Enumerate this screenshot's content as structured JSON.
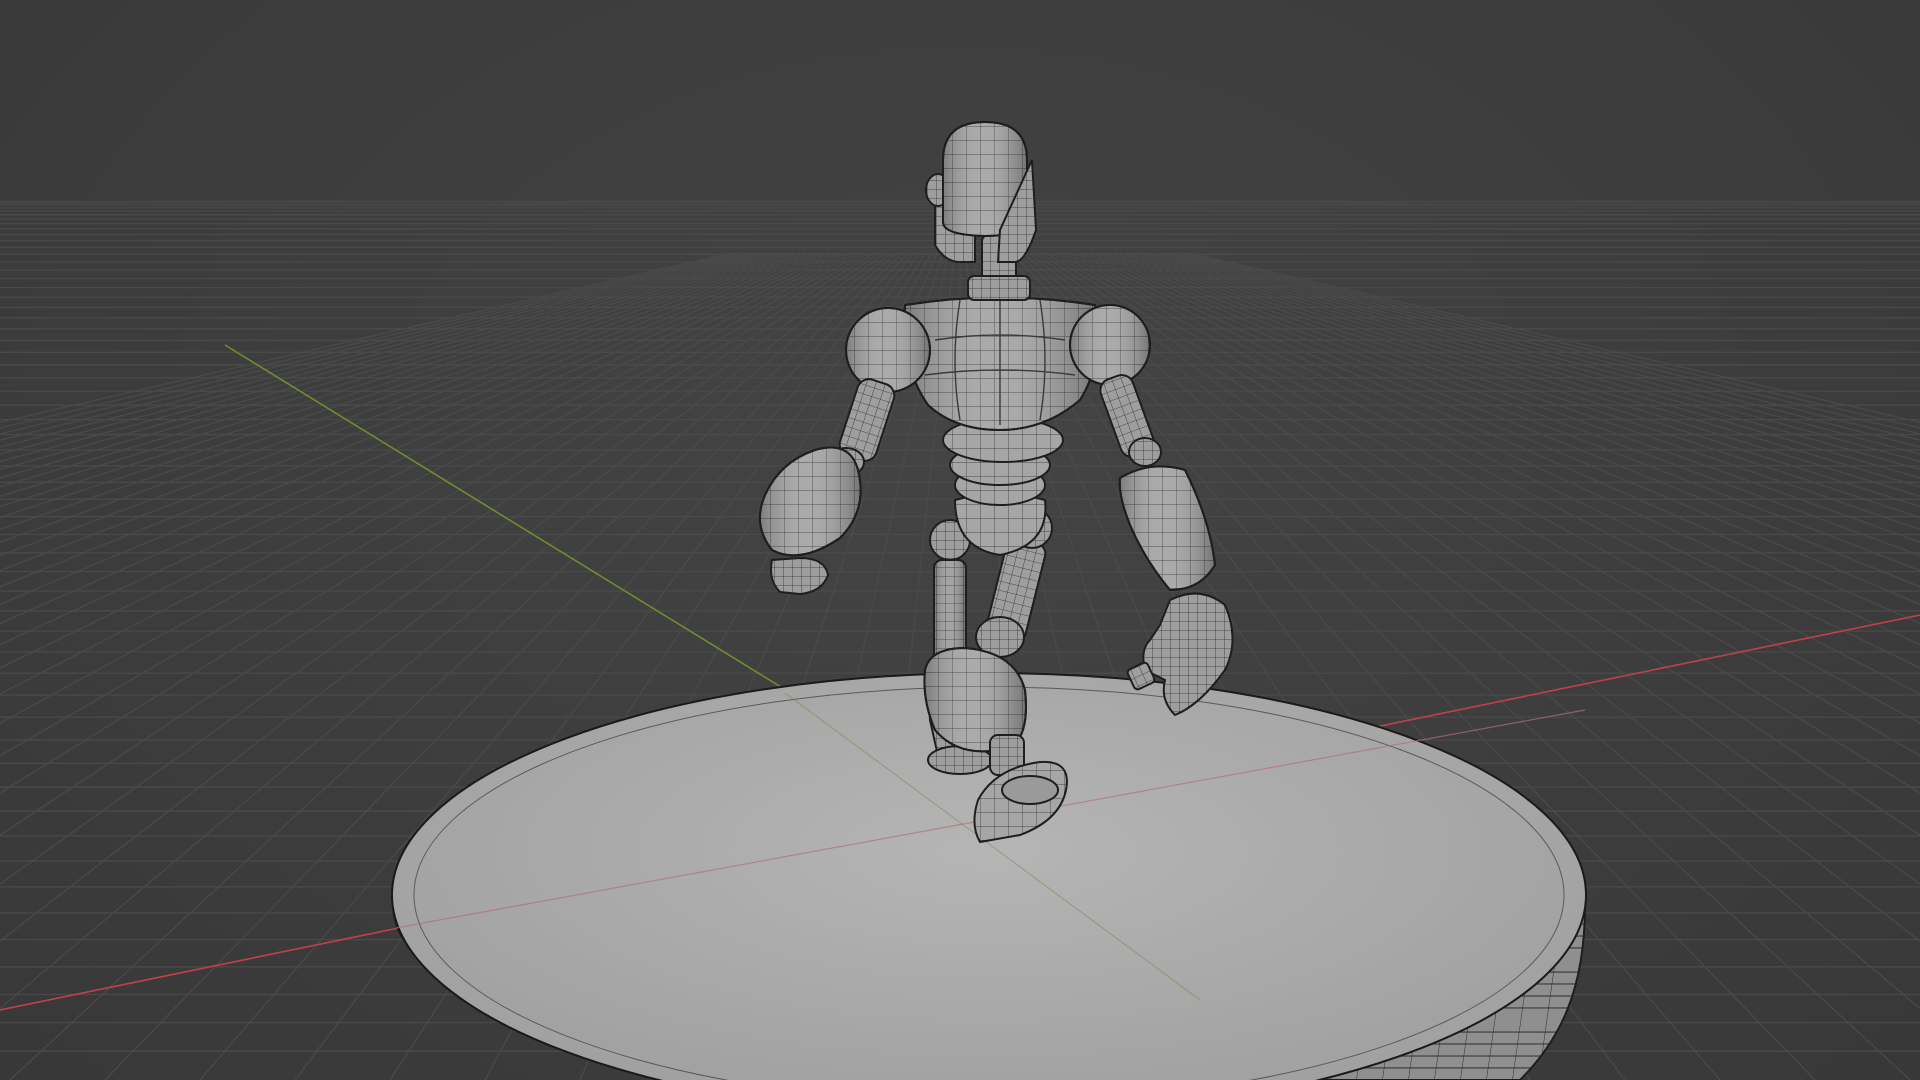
{
  "viewport": {
    "background_color": "#3d3d3d",
    "grid_line_color": "#4b4b4b",
    "x_axis_color": "#c0414b",
    "y_axis_color": "#6d8e2e"
  },
  "scene": {
    "shading": "wireframe-on-solid",
    "objects": [
      "robot-character",
      "circular-pedestal"
    ],
    "mesh_fill_color": "#a8a8a8",
    "wire_color": "#1e1e1e"
  }
}
